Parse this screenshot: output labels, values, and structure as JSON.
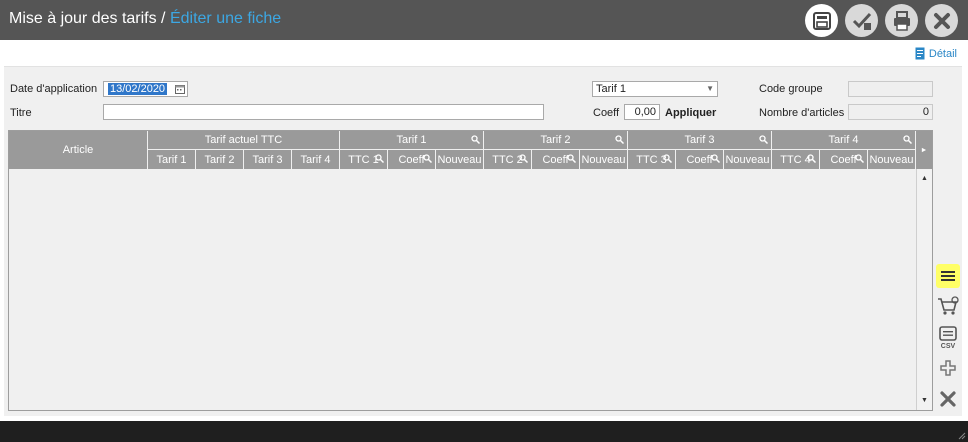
{
  "header": {
    "title": "Mise à jour des tarifs / ",
    "subtitle": "Éditer une fiche",
    "buttons": [
      {
        "name": "save-icon"
      },
      {
        "name": "validate-icon"
      },
      {
        "name": "print-icon"
      },
      {
        "name": "close-icon"
      }
    ]
  },
  "detail_link": "Détail",
  "form": {
    "date_label": "Date d'application",
    "date_value": "13/02/2020",
    "titre_label": "Titre",
    "titre_value": "",
    "tarif_select_value": "Tarif 1",
    "coeff_label": "Coeff",
    "coeff_value": "0,00",
    "apply_label": "Appliquer",
    "code_groupe_label": "Code groupe",
    "code_groupe_value": "",
    "nb_articles_label": "Nombre d'articles",
    "nb_articles_value": "0"
  },
  "grid": {
    "article_header": "Article",
    "group_headers": [
      "Tarif actuel TTC",
      "Tarif 1",
      "Tarif 2",
      "Tarif 3",
      "Tarif 4"
    ],
    "sub_headers": [
      "Tarif 1",
      "Tarif 2",
      "Tarif 3",
      "Tarif 4",
      "TTC 1",
      "Coeff",
      "Nouveau",
      "TTC 2",
      "Coeff",
      "Nouveau",
      "TTC 3",
      "Coeff",
      "Nouveau",
      "TTC 4",
      "Coeff",
      "Nouveau"
    ]
  },
  "side_tools": [
    "menu-icon",
    "cart-icon",
    "csv-icon",
    "add-icon",
    "delete-icon"
  ],
  "colors": {
    "titlebar": "#555555",
    "subtitle": "#3ca7e3",
    "grid_header": "#9a9a9a",
    "highlight": "#ffff66",
    "link": "#2a87c7"
  }
}
